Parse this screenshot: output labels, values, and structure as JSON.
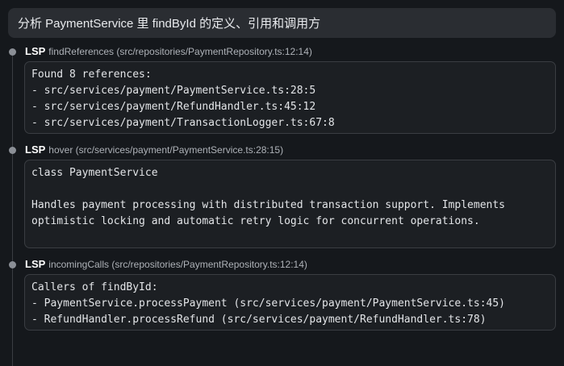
{
  "prompt": {
    "text": "分析 PaymentService 里 findById 的定义、引用和调用方"
  },
  "steps": [
    {
      "tool": "LSP",
      "name": "findReferences",
      "args": "(src/repositories/PaymentRepository.ts:12:14)",
      "lines": [
        "Found 8 references:",
        "- src/services/payment/PaymentService.ts:28:5",
        "- src/services/payment/RefundHandler.ts:45:12",
        "- src/services/payment/TransactionLogger.ts:67:8"
      ]
    },
    {
      "tool": "LSP",
      "name": "hover",
      "args": "(src/services/payment/PaymentService.ts:28:15)",
      "lines": [
        "class PaymentService",
        "",
        "Handles payment processing with distributed transaction support. Implements",
        "optimistic locking and automatic retry logic for concurrent operations.",
        ""
      ]
    },
    {
      "tool": "LSP",
      "name": "incomingCalls",
      "args": "(src/repositories/PaymentRepository.ts:12:14)",
      "lines": [
        "Callers of findById:",
        "- PaymentService.processPayment (src/services/payment/PaymentService.ts:45)",
        "- RefundHandler.processRefund (src/services/payment/RefundHandler.ts:78)"
      ]
    }
  ]
}
